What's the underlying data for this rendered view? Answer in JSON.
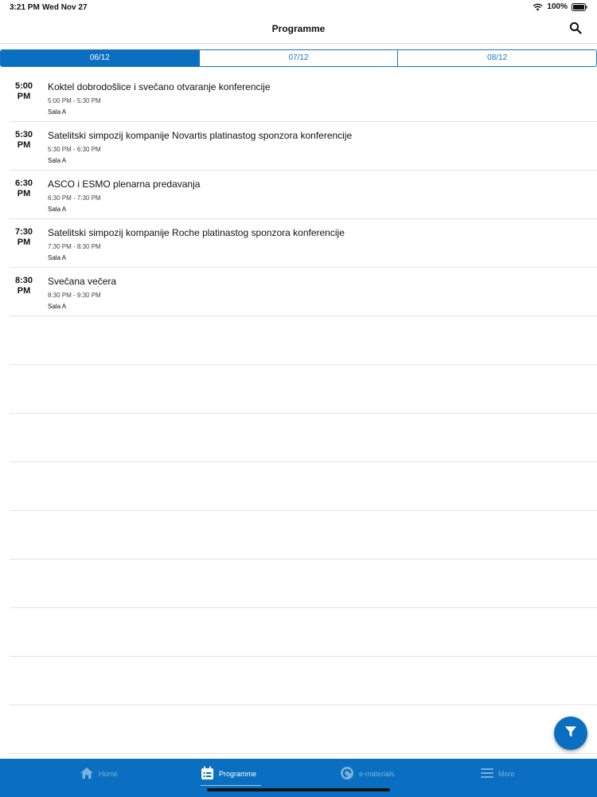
{
  "status_bar": {
    "time": "3:21 PM",
    "date": "Wed Nov 27",
    "battery": "100%"
  },
  "nav": {
    "title": "Programme",
    "search_icon": "search-icon"
  },
  "date_tabs": [
    {
      "label": "06/12",
      "active": true
    },
    {
      "label": "07/12",
      "active": false
    },
    {
      "label": "08/12",
      "active": false
    }
  ],
  "sessions": [
    {
      "time_hm": "5:00",
      "time_ampm": "PM",
      "title": "Koktel dobrodošlice i svečano otvaranje konferencije",
      "range": "5:00 PM - 5:30 PM",
      "room": "Sala A"
    },
    {
      "time_hm": "5:30",
      "time_ampm": "PM",
      "title": "Satelitski simpozij kompanije Novartis platinastog sponzora konferencije",
      "range": "5:30 PM - 6:30 PM",
      "room": "Sala A"
    },
    {
      "time_hm": "6:30",
      "time_ampm": "PM",
      "title": "ASCO i ESMO plenarna predavanja",
      "range": "6:30 PM - 7:30 PM",
      "room": "Sala A"
    },
    {
      "time_hm": "7:30",
      "time_ampm": "PM",
      "title": "Satelitski simpozij kompanije Roche platinastog sponzora konferencije",
      "range": "7:30 PM - 8:30 PM",
      "room": "Sala A"
    },
    {
      "time_hm": "8:30",
      "time_ampm": "PM",
      "title": "Svečana večera",
      "range": "8:30 PM - 9:30 PM",
      "room": "Sala A"
    }
  ],
  "tab_bar": {
    "items": [
      {
        "label": "Home",
        "icon": "home-icon",
        "active": false
      },
      {
        "label": "Programme",
        "icon": "calendar-icon",
        "active": true
      },
      {
        "label": "e-materials",
        "icon": "e-materials-icon",
        "active": false
      },
      {
        "label": "More",
        "icon": "menu-icon",
        "active": false
      }
    ]
  },
  "colors": {
    "accent": "#0a6fc0",
    "tab_border": "#1a73b8"
  }
}
